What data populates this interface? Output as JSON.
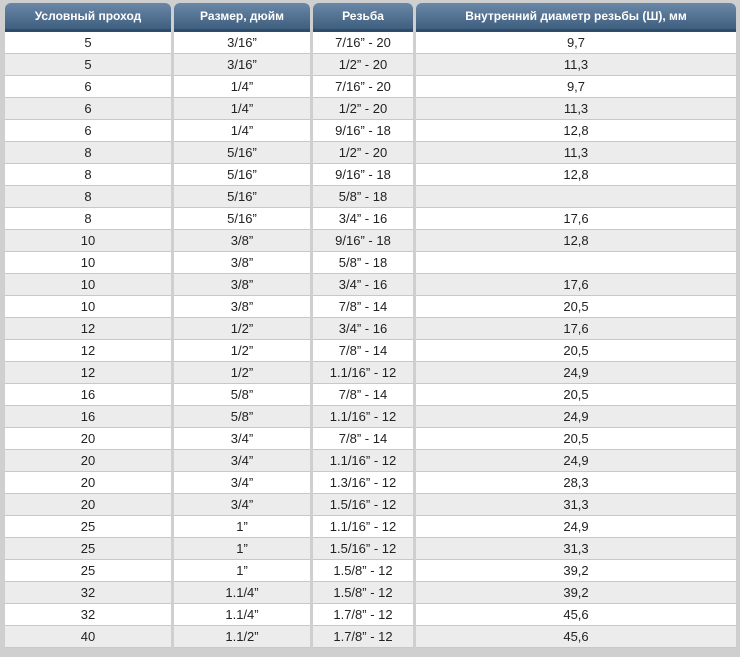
{
  "table": {
    "headers": [
      "Условный проход",
      "Размер, дюйм",
      "Резьба",
      "Внутренний диаметр резьбы (Ш), мм"
    ],
    "rows": [
      [
        "5",
        "3/16”",
        "7/16” - 20",
        "9,7"
      ],
      [
        "5",
        "3/16”",
        "1/2” - 20",
        "11,3"
      ],
      [
        "6",
        "1/4”",
        "7/16” - 20",
        "9,7"
      ],
      [
        "6",
        "1/4”",
        "1/2” - 20",
        "11,3"
      ],
      [
        "6",
        "1/4”",
        "9/16” - 18",
        "12,8"
      ],
      [
        "8",
        "5/16”",
        "1/2” - 20",
        "11,3"
      ],
      [
        "8",
        "5/16”",
        "9/16” - 18",
        "12,8"
      ],
      [
        "8",
        "5/16”",
        "5/8” - 18",
        ""
      ],
      [
        "8",
        "5/16”",
        "3/4” - 16",
        "17,6"
      ],
      [
        "10",
        "3/8”",
        "9/16” - 18",
        "12,8"
      ],
      [
        "10",
        "3/8”",
        "5/8” - 18",
        ""
      ],
      [
        "10",
        "3/8”",
        "3/4” - 16",
        "17,6"
      ],
      [
        "10",
        "3/8”",
        "7/8” - 14",
        "20,5"
      ],
      [
        "12",
        "1/2”",
        "3/4” - 16",
        "17,6"
      ],
      [
        "12",
        "1/2”",
        "7/8” - 14",
        "20,5"
      ],
      [
        "12",
        "1/2”",
        "1.1/16” - 12",
        "24,9"
      ],
      [
        "16",
        "5/8”",
        "7/8” - 14",
        "20,5"
      ],
      [
        "16",
        "5/8”",
        "1.1/16” - 12",
        "24,9"
      ],
      [
        "20",
        "3/4”",
        "7/8” - 14",
        "20,5"
      ],
      [
        "20",
        "3/4”",
        "1.1/16” - 12",
        "24,9"
      ],
      [
        "20",
        "3/4”",
        "1.3/16” - 12",
        "28,3"
      ],
      [
        "20",
        "3/4”",
        "1.5/16” - 12",
        "31,3"
      ],
      [
        "25",
        "1”",
        "1.1/16” - 12",
        "24,9"
      ],
      [
        "25",
        "1”",
        "1.5/16” - 12",
        "31,3"
      ],
      [
        "25",
        "1”",
        "1.5/8” - 12",
        "39,2"
      ],
      [
        "32",
        "1.1/4”",
        "1.5/8” - 12",
        "39,2"
      ],
      [
        "32",
        "1.1/4”",
        "1.7/8” - 12",
        "45,6"
      ],
      [
        "40",
        "1.1/2”",
        "1.7/8” - 12",
        "45,6"
      ]
    ]
  }
}
